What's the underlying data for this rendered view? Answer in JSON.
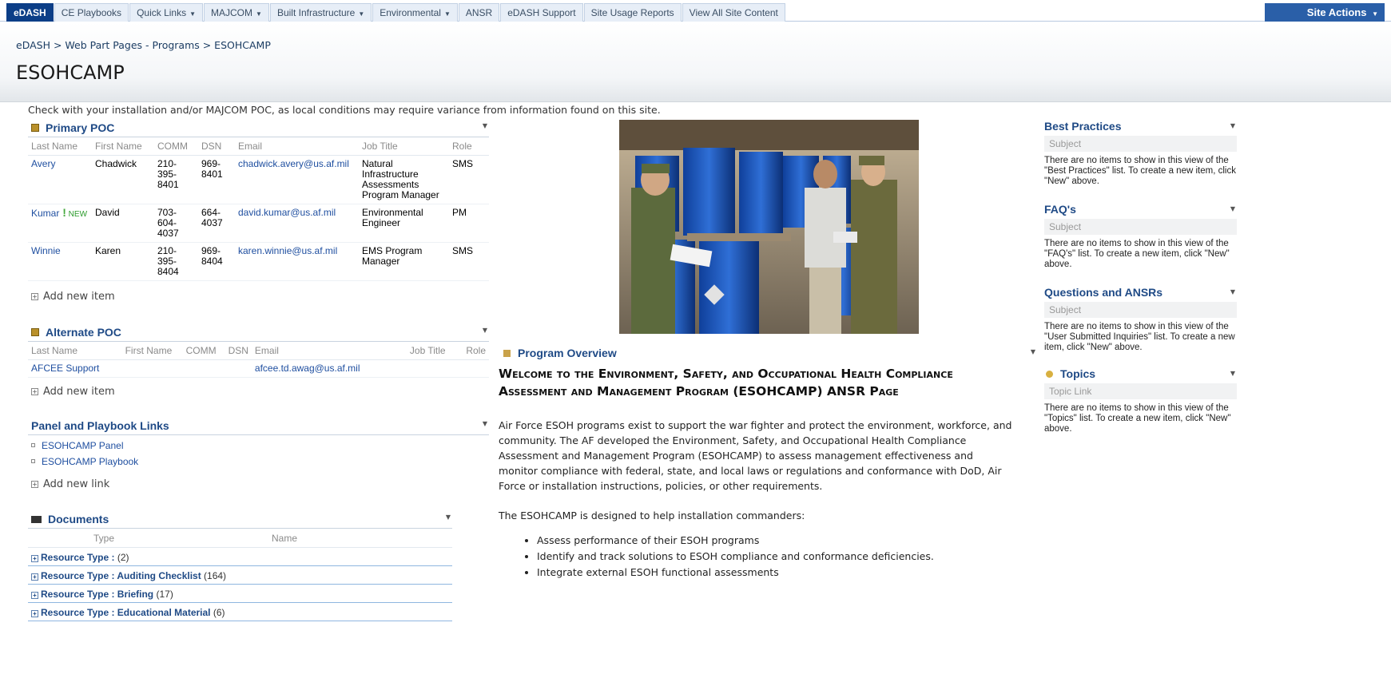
{
  "nav": {
    "tabs": [
      {
        "label": "eDASH",
        "dropdown": false
      },
      {
        "label": "CE Playbooks",
        "dropdown": false
      },
      {
        "label": "Quick Links",
        "dropdown": true
      },
      {
        "label": "MAJCOM",
        "dropdown": true
      },
      {
        "label": "Built Infrastructure",
        "dropdown": true
      },
      {
        "label": "Environmental",
        "dropdown": true
      },
      {
        "label": "ANSR",
        "dropdown": false
      },
      {
        "label": "eDASH Support",
        "dropdown": false
      },
      {
        "label": "Site Usage Reports",
        "dropdown": false
      },
      {
        "label": "View All Site Content",
        "dropdown": false
      }
    ],
    "site_actions": "Site Actions",
    "caret": "▼"
  },
  "breadcrumb": "eDASH > Web Part Pages - Programs > ESOHCAMP",
  "page_title": "ESOHCAMP",
  "notice": "Check with your installation and/or MAJCOM POC, as local conditions may require variance from information found on this site.",
  "primary_poc": {
    "title": "Primary POC",
    "columns": [
      "Last Name",
      "First Name",
      "COMM",
      "DSN",
      "Email",
      "Job Title",
      "Role"
    ],
    "rows": [
      {
        "last": "Avery",
        "new": false,
        "first": "Chadwick",
        "comm": "210-395-8401",
        "dsn": "969-8401",
        "email": "chadwick.avery@us.af.mil",
        "job": "Natural Infrastructure Assessments Program Manager",
        "role": "SMS"
      },
      {
        "last": "Kumar",
        "new": true,
        "first": "David",
        "comm": "703-604-4037",
        "dsn": "664-4037",
        "email": "david.kumar@us.af.mil",
        "job": "Environmental Engineer",
        "role": "PM"
      },
      {
        "last": "Winnie",
        "new": false,
        "first": "Karen",
        "comm": "210-395-8404",
        "dsn": "969-8404",
        "email": "karen.winnie@us.af.mil",
        "job": "EMS Program Manager",
        "role": "SMS"
      }
    ],
    "new_label": "NEW",
    "add_new": "Add new item"
  },
  "alternate_poc": {
    "title": "Alternate POC",
    "columns": [
      "Last Name",
      "First Name",
      "COMM",
      "DSN",
      "Email",
      "Job Title",
      "Role"
    ],
    "rows": [
      {
        "last": "AFCEE Support",
        "email": "afcee.td.awag@us.af.mil"
      }
    ],
    "add_new": "Add new item"
  },
  "panel_links": {
    "title": "Panel and Playbook Links",
    "items": [
      "ESOHCAMP Panel",
      "ESOHCAMP Playbook"
    ],
    "add_new": "Add new link"
  },
  "documents": {
    "title": "Documents",
    "columns": [
      "Type",
      "Name"
    ],
    "groups": [
      {
        "label": "Resource Type :",
        "name": "",
        "count": "(2)"
      },
      {
        "label": "Resource Type :",
        "name": "Auditing Checklist",
        "count": "(164)"
      },
      {
        "label": "Resource Type :",
        "name": "Briefing",
        "count": "(17)"
      },
      {
        "label": "Resource Type :",
        "name": "Educational Material",
        "count": "(6)"
      }
    ]
  },
  "overview": {
    "title": "Program Overview",
    "welcome": "Welcome to the Environment, Safety, and Occupational Health Compliance Assessment and Management Program (ESOHCAMP) ANSR Page",
    "para1": "Air Force ESOH programs exist to support the war fighter and protect the environment, workforce, and community. The AF developed the Environment, Safety, and Occupational Health Compliance Assessment and Management Program (ESOHCAMP) to assess management effectiveness and monitor compliance with federal, state, and local laws or regulations and conformance with DoD, Air Force or installation instructions, policies, or other requirements.",
    "para2": "The ESOHCAMP is designed to help installation commanders:",
    "bullets": [
      "Assess performance of their ESOH programs",
      "Identify and track solutions to ESOH compliance and conformance deficiencies.",
      "Integrate external ESOH functional assessments"
    ]
  },
  "right": {
    "best_practices": {
      "title": "Best Practices",
      "sub": "Subject",
      "msg": "There are no items to show in this view of the \"Best Practices\" list. To create a new item, click \"New\" above."
    },
    "faq": {
      "title": "FAQ's",
      "sub": "Subject",
      "msg": "There are no items to show in this view of the \"FAQ's\" list. To create a new item, click \"New\" above."
    },
    "questions": {
      "title": "Questions and ANSRs",
      "sub": "Subject",
      "msg": "There are no items to show in this view of the \"User Submitted Inquiries\" list. To create a new item, click \"New\" above."
    },
    "topics": {
      "title": "Topics",
      "sub": "Topic Link",
      "msg": "There are no items to show in this view of the \"Topics\" list. To create a new item, click \"New\" above."
    }
  },
  "colors": {
    "nav_active": "#0c3e87",
    "link": "#1f4fa0",
    "webpart_title": "#1f4a86",
    "new_badge": "#46a93e"
  }
}
